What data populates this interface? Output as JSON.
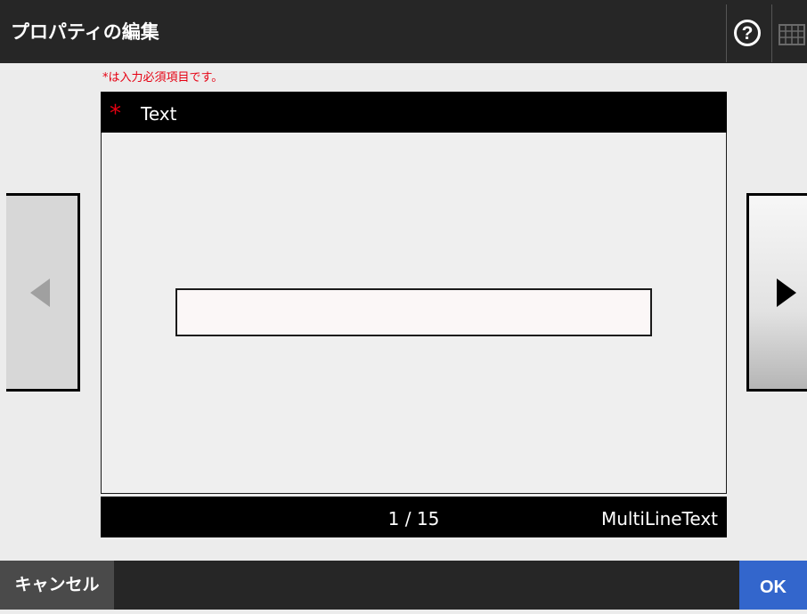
{
  "header": {
    "title": "プロパティの編集",
    "help_icon": "question-circle-icon",
    "help_glyph": "?",
    "keyboard_icon": "keyboard-icon"
  },
  "form": {
    "required_note": "*は入力必須項目です。",
    "field_label": "Text",
    "required_mark": "*",
    "input_value": "",
    "page_indicator": "1 / 15",
    "field_type": "MultiLineText"
  },
  "navigation": {
    "prev_icon": "triangle-left-icon",
    "next_icon": "triangle-right-icon"
  },
  "footer": {
    "cancel_label": "キャンセル",
    "ok_label": "OK"
  },
  "colors": {
    "bar_background": "#262626",
    "required_red": "#e60012",
    "ok_blue": "#3366cc",
    "panel_black": "#000000"
  }
}
